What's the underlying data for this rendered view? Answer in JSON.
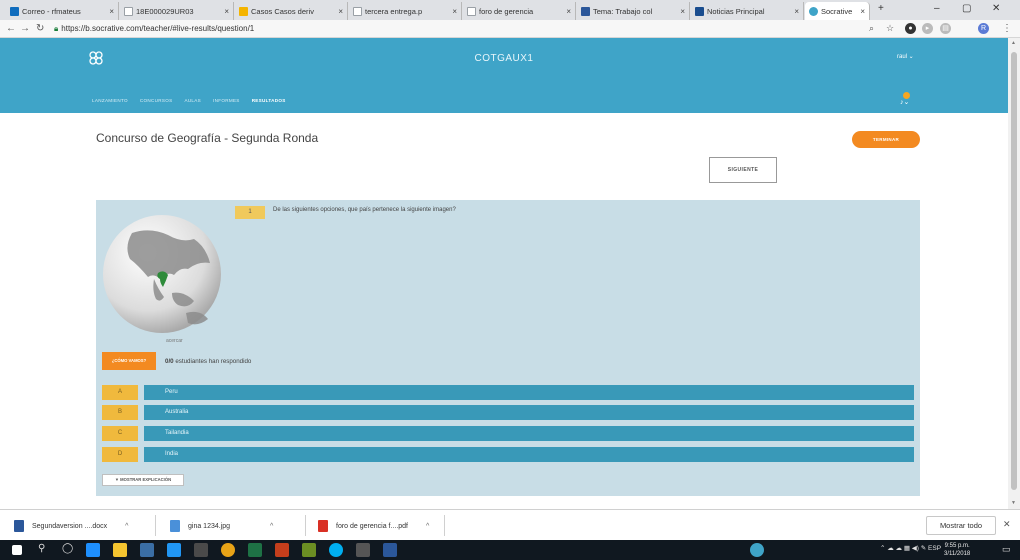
{
  "browser": {
    "tabs": [
      {
        "label": "Correo - rfmateus",
        "icon_color": "#0f6cbd"
      },
      {
        "label": "18E000029UR03",
        "icon_color": "#9aa0a6"
      },
      {
        "label": "Casos Casos deriv",
        "icon_color": "#f4b400"
      },
      {
        "label": "tercera entrega.p",
        "icon_color": "#9aa0a6"
      },
      {
        "label": "foro de gerencia",
        "icon_color": "#9aa0a6"
      },
      {
        "label": "Tema: Trabajo col",
        "icon_color": "#2b579a"
      },
      {
        "label": "Noticias Principal",
        "icon_color": "#1a4d8f"
      },
      {
        "label": "Socrative",
        "icon_color": "#3fa4c8"
      }
    ],
    "url": "https://b.socrative.com/teacher/#live-results/question/1"
  },
  "header": {
    "room_name": "COTGAUX1",
    "user": "raul ⌄",
    "nav": [
      "LANZAMIENTO",
      "CONCURSOS",
      "AULAS",
      "INFORMES",
      "RESULTADOS"
    ],
    "active_nav": "RESULTADOS",
    "brand_color": "#3fa4c8"
  },
  "quiz": {
    "title": "Concurso de Geografía - Segunda Ronda",
    "finish_label": "TERMINAR",
    "next_label": "SIGUIENTE",
    "question_number": "1",
    "question_text": "De las siguientes opciones, que país pertenece la siguiente imagen?",
    "zoom_label": "acercar",
    "how_label": "¿CÓMO VAMOS?",
    "responded_count": "0/0",
    "responded_text": "estudiantes han respondido",
    "answers": [
      {
        "letter": "A",
        "text": "Peru"
      },
      {
        "letter": "B",
        "text": "Australia"
      },
      {
        "letter": "C",
        "text": "Tailandia"
      },
      {
        "letter": "D",
        "text": "India"
      }
    ],
    "show_explanation_label": "▼ MOSTRAR EXPLICACIÓN"
  },
  "downloads": {
    "items": [
      {
        "name": "Segundaversion ....docx",
        "color": "#2b579a"
      },
      {
        "name": "gina 1234.jpg",
        "color": "#4a90d9"
      },
      {
        "name": "foro de gerencia f....pdf",
        "color": "#d93025"
      }
    ],
    "show_all": "Mostrar todo"
  },
  "taskbar": {
    "lang": "ESP",
    "time": "9:55 p.m.",
    "date": "3/11/2018"
  }
}
